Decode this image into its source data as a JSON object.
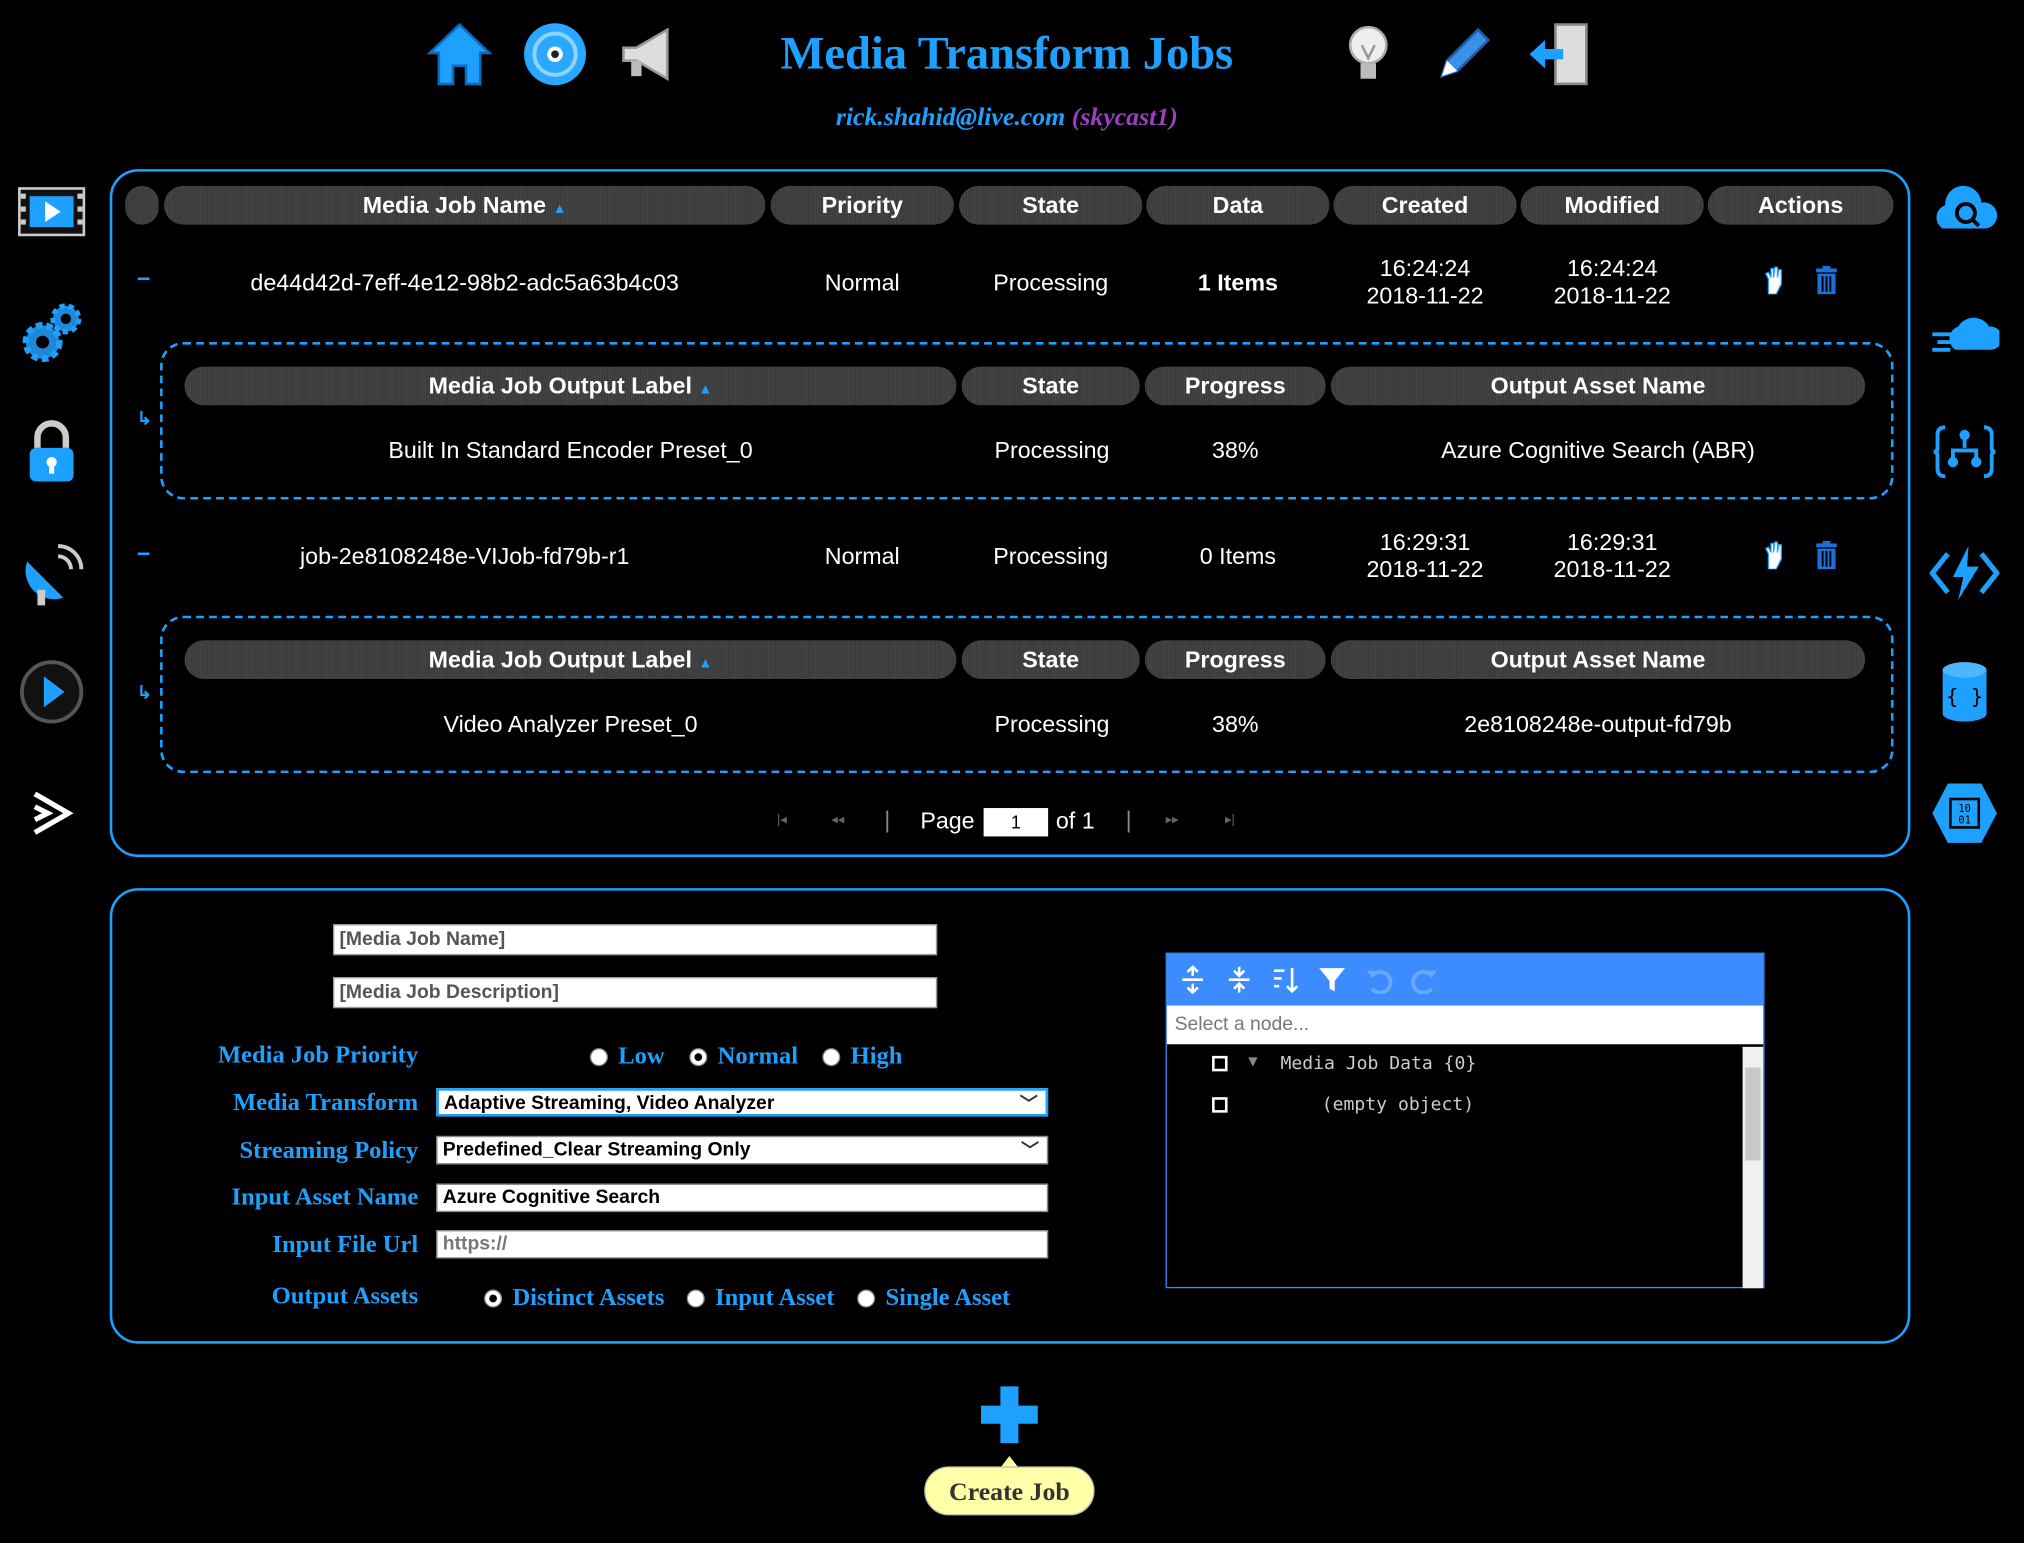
{
  "header": {
    "title": "Media Transform Jobs",
    "user_email": "rick.shahid@live.com",
    "user_account": "(skycast1)",
    "icons_left": [
      "home-icon",
      "disc-icon",
      "megaphone-icon"
    ],
    "icons_right": [
      "lightbulb-icon",
      "pencil-icon",
      "signout-icon"
    ]
  },
  "sidebar_left": [
    "film-icon",
    "gears-icon",
    "lock-icon",
    "satellite-icon",
    "play-icon",
    "stream-icon"
  ],
  "sidebar_right": [
    "cloud-search-icon",
    "cloud-fast-icon",
    "json-tree-icon",
    "function-icon",
    "database-icon",
    "binary-hex-icon"
  ],
  "jobs_table": {
    "columns": {
      "name": "Media Job Name",
      "priority": "Priority",
      "state": "State",
      "data": "Data",
      "created": "Created",
      "modified": "Modified",
      "actions": "Actions"
    },
    "rows": [
      {
        "toggle": "−",
        "name": "de44d42d-7eff-4e12-98b2-adc5a63b4c03",
        "priority": "Normal",
        "state": "Processing",
        "data": "1 Items",
        "created_time": "16:24:24",
        "created_date": "2018-11-22",
        "modified_time": "16:24:24",
        "modified_date": "2018-11-22"
      },
      {
        "toggle": "−",
        "name": "job-2e8108248e-VIJob-fd79b-r1",
        "priority": "Normal",
        "state": "Processing",
        "data": "0 Items",
        "created_time": "16:29:31",
        "created_date": "2018-11-22",
        "modified_time": "16:29:31",
        "modified_date": "2018-11-22"
      }
    ],
    "sub_columns": {
      "label": "Media Job Output Label",
      "state": "State",
      "progress": "Progress",
      "asset": "Output Asset Name"
    },
    "sub_rows": [
      {
        "label": "Built In Standard Encoder Preset_0",
        "state": "Processing",
        "progress": "38%",
        "asset": "Azure Cognitive Search (ABR)"
      },
      {
        "label": "Video Analyzer Preset_0",
        "state": "Processing",
        "progress": "38%",
        "asset": "2e8108248e-output-fd79b"
      }
    ],
    "sub_indicator": "↳",
    "pager": {
      "page_label": "Page",
      "page_value": "1",
      "of_label": "of 1",
      "sep": "|"
    }
  },
  "form": {
    "job_name_placeholder": "[Media Job Name]",
    "job_desc_placeholder": "[Media Job Description]",
    "priority_label": "Media Job Priority",
    "priority_options": [
      "Low",
      "Normal",
      "High"
    ],
    "priority_selected": "Normal",
    "transform_label": "Media Transform",
    "transform_value": "Adaptive Streaming, Video Analyzer",
    "policy_label": "Streaming Policy",
    "policy_value": "Predefined_Clear Streaming Only",
    "input_asset_label": "Input Asset Name",
    "input_asset_value": "Azure Cognitive Search",
    "input_url_label": "Input File Url",
    "input_url_placeholder": "https://",
    "output_label": "Output Assets",
    "output_options": [
      "Distinct Assets",
      "Input Asset",
      "Single Asset"
    ],
    "output_selected": "Distinct Assets"
  },
  "json_editor": {
    "search_placeholder": "Select a node...",
    "root_label": "Media Job Data {0}",
    "empty_label": "(empty object)"
  },
  "create_job": {
    "label": "Create Job"
  },
  "colors": {
    "accent": "#1ea0ff",
    "user_account": "#9b3fbf",
    "button_bg": "#ffffa8"
  }
}
